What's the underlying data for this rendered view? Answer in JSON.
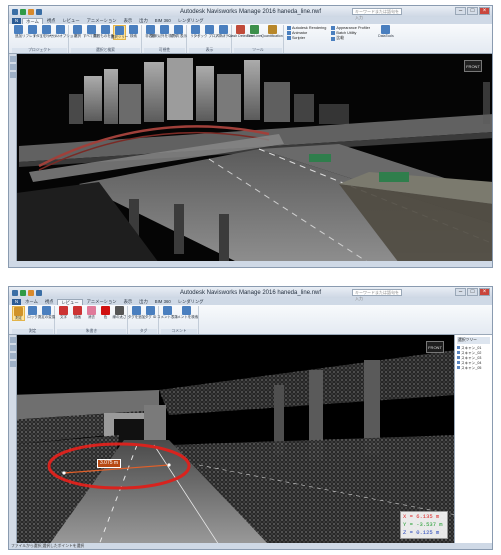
{
  "window1": {
    "title": "Autodesk Navisworks Manage 2016   haneda_line.nwf",
    "search_placeholder": "キーワードまたは語句を入力",
    "tabs": [
      "ホーム",
      "視点",
      "レビュー",
      "アニメーション",
      "表示",
      "出力",
      "BIM 360",
      "レンダリング"
    ],
    "active_tab": "ホーム",
    "ribbon_groups": [
      {
        "label": "プロジェクト",
        "buttons": [
          "追加",
          "リフレッシュ",
          "すべてをリセット",
          "ファイル オプション"
        ]
      },
      {
        "label": "選択と検索",
        "buttons": [
          "選択",
          "すべて選択",
          "同じものを選択",
          "選択ツリー",
          "検索"
        ]
      },
      {
        "label": "可視性",
        "buttons": [
          "非表示",
          "選択以外を非表示",
          "すべて表示"
        ]
      },
      {
        "label": "表示",
        "buttons": [
          "リンク",
          "クイック プロパティ",
          "プロパティ"
        ]
      },
      {
        "label": "ツール",
        "buttons": [
          "Clash Detective",
          "TimeLiner",
          "Quantification"
        ]
      }
    ],
    "side_list": [
      "Autodesk Rendering",
      "Animator",
      "Scripter",
      "Appearance Profiler",
      "Batch Utility",
      "比較",
      "DataTools"
    ],
    "status_text": ""
  },
  "window2": {
    "title": "Autodesk Navisworks Manage 2016   haneda_line.nwf",
    "search_placeholder": "キーワードまたは語句を入力",
    "tabs": [
      "ホーム",
      "視点",
      "レビュー",
      "アニメーション",
      "表示",
      "出力",
      "BIM 360",
      "レンダリング"
    ],
    "active_tab": "レビュー",
    "ribbon_groups": [
      {
        "label": "測定",
        "buttons": [
          "測定",
          "ロック",
          "測定の変換"
        ]
      },
      {
        "label": "朱書き",
        "buttons": [
          "文字",
          "描画",
          "消去",
          "色",
          "線の太さ"
        ]
      },
      {
        "label": "タグ",
        "buttons": [
          "タグを追加",
          "タグ ID"
        ]
      },
      {
        "label": "コメント",
        "buttons": [
          "コメント表示",
          "コメントを検索"
        ]
      }
    ],
    "measurement_label": "3.075 m",
    "coordinates": {
      "x": "X = 6.135 m",
      "y": "Y = -3.537 m",
      "z": "Z = 0.125 m"
    },
    "selection_panel": {
      "title": "選択ツリー",
      "items": [
        "スキャン_01",
        "スキャン_02",
        "スキャン_03",
        "スキャン_04",
        "スキャン_05"
      ]
    },
    "status_text": "ファイルから選択,選択したポイントを選択"
  },
  "colors": {
    "highlight_circle": "#d8231e",
    "measure_label_bg": "#b84a14",
    "app_button": "#2c5c95"
  }
}
